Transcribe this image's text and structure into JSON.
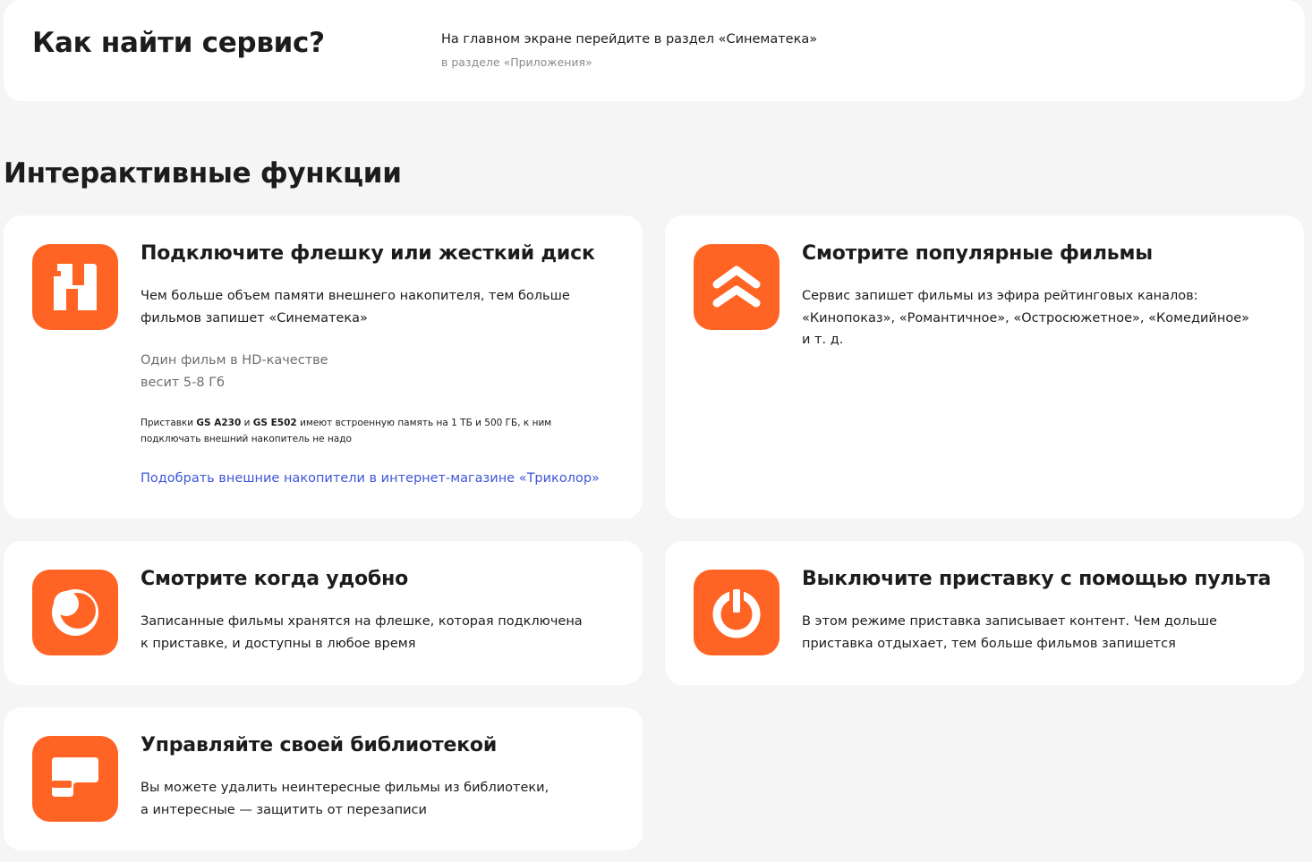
{
  "find_service": {
    "title": "Как найти сервис?",
    "line1": "На главном экране перейдите в раздел «Синематека»",
    "line2": "в разделе «Приложения»"
  },
  "section": {
    "title": "Интерактивные функции"
  },
  "colors": {
    "accent": "#ff6424",
    "link": "#3f56d9",
    "card_bg": "#ffffff",
    "page_bg": "#f5f5f5"
  },
  "features": [
    {
      "icon": "storage-icon",
      "title": "Подключите флешку или жесткий диск",
      "text": "Чем больше объем памяти внешнего накопителя, тем больше\nфильмов запишет «Синематека»",
      "note": "Один фильм в HD-качестве\nвесит 5-8 Гб",
      "small_parts": {
        "p1": "Приставки ",
        "m1": "GS A230",
        "p2": " и ",
        "m2": "GS E502",
        "p3": " имеют встроенную память на 1 ТБ и 500 ГБ, к ним подключать внешний накопитель не надо"
      },
      "link": "Подобрать внешние накопители в интернет-магазине «Триколор»"
    },
    {
      "icon": "chevrons-up-icon",
      "title": "Смотрите популярные фильмы",
      "text": "Сервис запишет фильмы из эфира рейтинговых каналов:\n«Кинопоказ», «Романтичное», «Остросюжетное», «Комедийное»\nи т. д."
    },
    {
      "icon": "moon-icon",
      "title": "Смотрите когда удобно",
      "text": "Записанные фильмы хранятся на флешке, которая подключена\nк приставке, и доступны в любое время"
    },
    {
      "icon": "power-icon",
      "title": "Выключите приставку с помощью пульта",
      "text": "В этом режиме приставка записывает контент. Чем дольше\nприставка отдыхает, тем больше фильмов запишется"
    },
    {
      "icon": "library-icon",
      "title": "Управляйте своей библиотекой",
      "text": "Вы можете удалить неинтересные фильмы из библиотеки,\nа интересные — защитить от перезаписи"
    }
  ]
}
